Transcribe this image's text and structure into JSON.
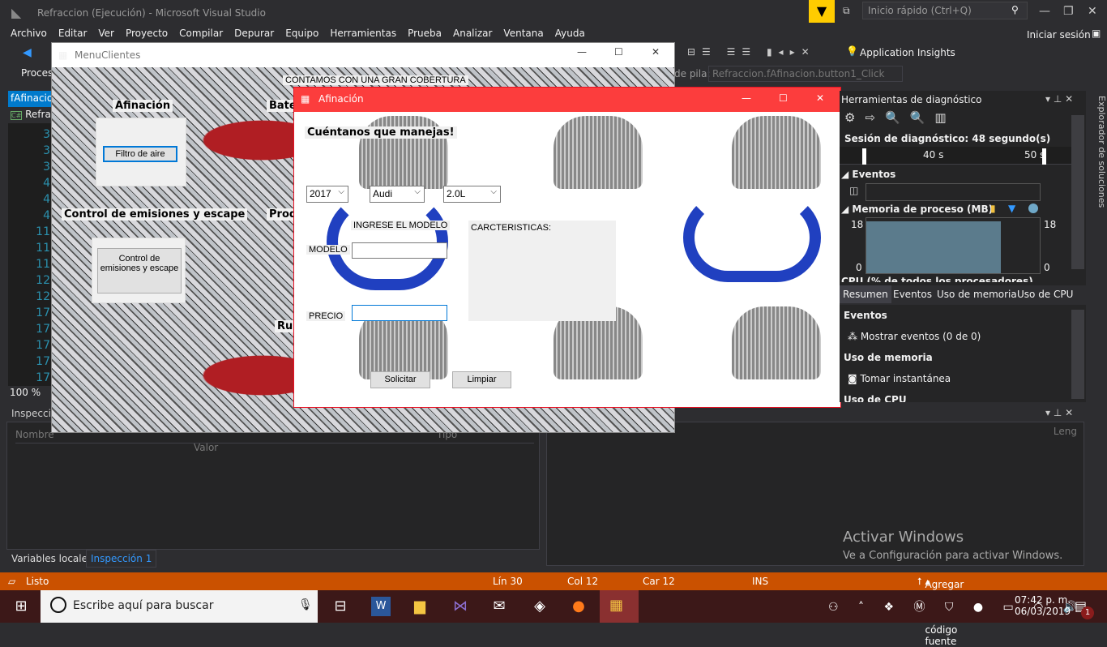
{
  "window": {
    "title": "Refraccion (Ejecución) - Microsoft Visual Studio",
    "quick_launch_placeholder": "Inicio rápido (Ctrl+Q)",
    "sign_in": "Iniciar sesión"
  },
  "menu": [
    "Archivo",
    "Editar",
    "Ver",
    "Proyecto",
    "Compilar",
    "Depurar",
    "Equipo",
    "Herramientas",
    "Prueba",
    "Analizar",
    "Ventana",
    "Ayuda"
  ],
  "toolbar": {
    "process_label": "Proces",
    "app_insights": "Application Insights",
    "stack_label": "de pila:",
    "stack_value": "Refraccion.fAfinacion.button1_Click"
  },
  "editor": {
    "tab": "fAfinacion",
    "file": "Refraccion",
    "line_numbers": [
      "3",
      "3",
      "3",
      "4",
      "4",
      "4",
      "11",
      "11",
      "11",
      "12",
      "12",
      "17",
      "17",
      "17",
      "17",
      "17"
    ],
    "zoom": "100 %"
  },
  "watch": {
    "title": "Inspección",
    "columns": [
      "Nombre",
      "Valor",
      "Tipo"
    ],
    "tabs": [
      "Variables locales",
      "Inspección 1"
    ]
  },
  "output_panel": {
    "column": "Leng"
  },
  "menu_clientes": {
    "title": "MenuClientes",
    "banner": "CONTAMOS CON UNA GRAN COBERTURA",
    "labels": [
      "Afinación",
      "Bate",
      "Control de emisiones y escape",
      "Prod",
      "Ru"
    ],
    "buttons": [
      "Filtro de aire",
      "Control de emisiones y escape"
    ]
  },
  "afinacion": {
    "title": "Afinación",
    "heading": "Cuéntanos que manejas!",
    "year": "2017",
    "brand": "Audi",
    "engine": "2.0L",
    "model_hint": "INGRESE EL MODELO",
    "model_label": "MODELO",
    "price_label": "PRECIO",
    "features_label": "CARCTERISTICAS:",
    "model_value": "",
    "price_value": "",
    "solicit": "Solicitar",
    "clear": "Limpiar"
  },
  "diagnostics": {
    "title": "Herramientas de diagnóstico",
    "session": "Sesión de diagnóstico: 48 segundo(s)",
    "ticks": [
      "40 s",
      "50 s"
    ],
    "events": "Eventos",
    "memory_title": "Memoria de proceso (MB)",
    "mem_max": "18",
    "mem_min": "0",
    "memory_value_mb": 17,
    "cpu_title": "CPU (% de todos los procesadores)",
    "tabs": [
      "Resumen",
      "Eventos",
      "Uso de memoria",
      "Uso de CPU"
    ],
    "sections": [
      "Eventos",
      "Uso de memoria",
      "Uso de CPU"
    ],
    "show_events": "Mostrar eventos (0 de 0)",
    "snapshot": "Tomar instantánea"
  },
  "solution_explorer": "Explorador de soluciones",
  "watermark": {
    "title": "Activar Windows",
    "sub": "Ve a Configuración para activar Windows."
  },
  "status": {
    "ready": "Listo",
    "line": "Lín 30",
    "col": "Col 12",
    "char": "Car 12",
    "mode": "INS",
    "source_control": "Agregar al control de código fuente"
  },
  "taskbar": {
    "search_placeholder": "Escribe aquí para buscar",
    "time": "07:42 p. m.",
    "date": "06/03/2019",
    "notifications": "1"
  },
  "colors": {
    "accent": "#007acc",
    "status": "#ca5100",
    "afinacion_title": "#fc3d3d"
  }
}
